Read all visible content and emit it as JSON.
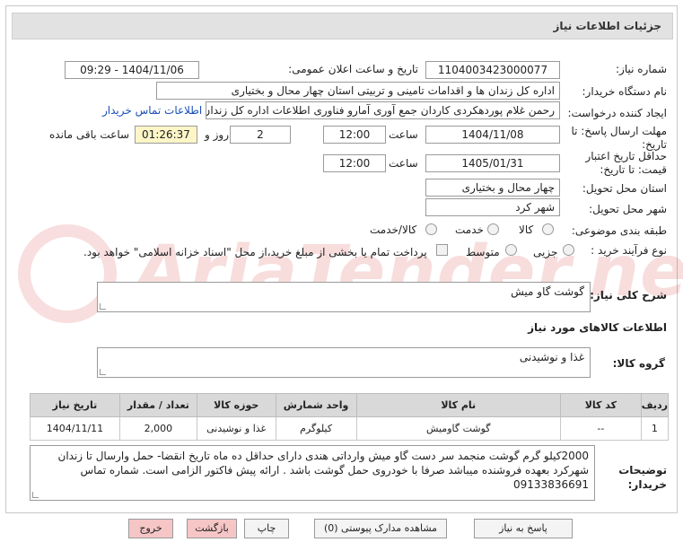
{
  "header": {
    "title": "جزئیات اطلاعات نیاز"
  },
  "fields": {
    "need_number_label": "شماره نیاز:",
    "need_number": "1104003423000077",
    "announce_label": "تاریخ و ساعت اعلان عمومی:",
    "announce_value": "1404/11/06 - 09:29",
    "buyer_label": "نام دستگاه خریدار:",
    "buyer_value": "اداره کل زندان ها و اقدامات تامینی و تربیتی استان چهار محال و بختیاری",
    "creator_label": "ایجاد کننده درخواست:",
    "creator_value": "رحمن غلام پوردهکردی کاردان جمع آوری آمارو فناوری اطلاعات اداره کل زندان ها",
    "contact_link": "اطلاعات تماس خریدار",
    "deadline_label": "مهلت ارسال پاسخ: تا تاریخ:",
    "deadline_date": "1404/11/08",
    "time_label": "ساعت",
    "deadline_time": "12:00",
    "days_value": "2",
    "days_label": "روز و",
    "remaining_value": "01:26:37",
    "remaining_label": "ساعت باقی مانده",
    "validity_label": "حداقل تاریخ اعتبار قیمت: تا تاریخ:",
    "validity_date": "1405/01/31",
    "validity_time": "12:00",
    "province_label": "استان محل تحویل:",
    "province_value": "چهار محال و بختیاری",
    "city_label": "شهر محل تحویل:",
    "city_value": "شهر کرد",
    "category_label": "طبقه بندی موضوعی:",
    "category_options": [
      "کالا",
      "خدمت",
      "کالا/خدمت"
    ],
    "process_label": "نوع فرآیند خرید :",
    "process_options": [
      "جزیی",
      "متوسط"
    ],
    "payment_note": "پرداخت تمام یا بخشی از مبلغ خرید،از محل \"اسناد خزانه اسلامی\" خواهد بود."
  },
  "description": {
    "label": "شرح کلی نیاز:",
    "value": "گوشت گاو میش"
  },
  "goods_section": {
    "title": "اطلاعات کالاهای مورد نیاز"
  },
  "goods_group": {
    "label": "گروه کالا:",
    "value": "غذا و نوشیدنی"
  },
  "table": {
    "headers": [
      "ردیف",
      "کد کالا",
      "نام کالا",
      "واحد شمارش",
      "حوزه کالا",
      "تعداد / مقدار",
      "تاریخ نیاز"
    ],
    "rows": [
      [
        "1",
        "--",
        "گوشت گاومیش",
        "کیلوگرم",
        "غذا و نوشیدنی",
        "2,000",
        "1404/11/11"
      ]
    ]
  },
  "buyer_notes": {
    "label": "توضیحات خریدار:",
    "value": "2000کیلو گرم گوشت منجمد سر دست گاو میش  وارداتی هندی دارای حداقل ده ماه تاریخ انقضا- حمل وارسال تا زندان شهرکرد بعهده فروشنده میباشد صرفا با خودروی حمل گوشت باشد . ارائه پیش فاکتور الزامی است. شماره تماس 09133836691"
  },
  "buttons": {
    "reply": "پاسخ به نیاز",
    "attachments": "مشاهده مدارک پیوستی (0)",
    "print": "چاپ",
    "back": "بازگشت",
    "exit": "خروج"
  }
}
